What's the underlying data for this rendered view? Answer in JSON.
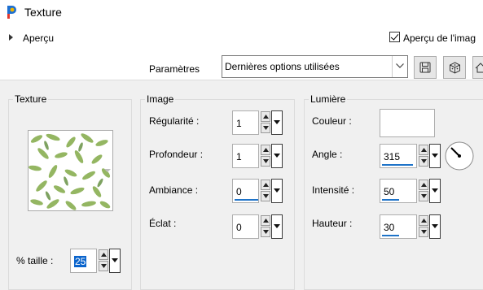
{
  "window": {
    "title": "Texture"
  },
  "preview": {
    "toggle_label": "Aperçu",
    "image_preview_label": "Aperçu de l'imag",
    "image_preview_checked": true
  },
  "params": {
    "label": "Paramètres",
    "selected": "Dernières options utilisées"
  },
  "texture_group": {
    "title": "Texture",
    "size_label": "% taille :",
    "size_value": "25"
  },
  "image_group": {
    "title": "Image",
    "regularity_label": "Régularité :",
    "regularity_value": "1",
    "depth_label": "Profondeur :",
    "depth_value": "1",
    "ambient_label": "Ambiance :",
    "ambient_value": "0",
    "shine_label": "Éclat :",
    "shine_value": "0"
  },
  "light_group": {
    "title": "Lumière",
    "color_label": "Couleur :",
    "color_value": "#ffffff",
    "angle_label": "Angle :",
    "angle_value": "315",
    "intensity_label": "Intensité :",
    "intensity_value": "50",
    "elevation_label": "Hauteur :",
    "elevation_value": "30"
  },
  "icons": [
    "app-logo-icon",
    "expand-arrow-icon",
    "checkbox-icon",
    "chevron-down-icon",
    "save-icon",
    "random-icon",
    "reset-icon",
    "spin-up-icon",
    "spin-down-icon",
    "angle-dial-icon"
  ]
}
